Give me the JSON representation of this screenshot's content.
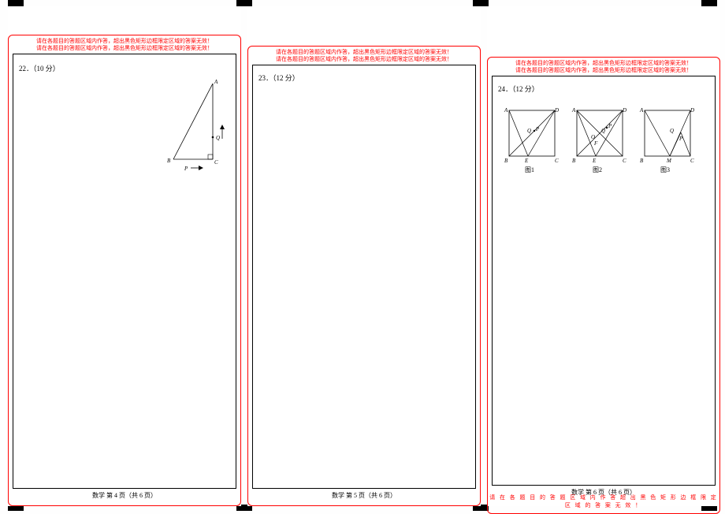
{
  "warnings": {
    "line1": "请在各题目的答题区域内作答，超出黑色矩形边框限定区域的答案无效！",
    "line2": "请在各题目的答题区域内作答，超出黑色矩形边框限定区域的答案无效！",
    "bottom": "请 在 各 题 目 的 答 题 区 域 内 作 答       超 出 黑 色 矩 形 边 框 限 定 区 域 的 答 案 无 效 ！"
  },
  "col1": {
    "question": "22．（10 分）",
    "footer": "数学  第 4 页（共 6 页）",
    "triangle": {
      "A": "A",
      "B": "B",
      "C": "C",
      "P": "P",
      "Q": "Q"
    }
  },
  "col2": {
    "question": "23．（12 分）",
    "footer": "数学  第 5 页（共 6 页）"
  },
  "col3": {
    "question": "24．（12 分）",
    "footer": "数学  第 6 页（共 6 页）",
    "fig": {
      "A": "A",
      "B": "B",
      "C": "C",
      "D": "D",
      "E": "E",
      "F": "F",
      "P": "P",
      "Q": "Q",
      "O": "O",
      "M": "M",
      "cap1": "图1",
      "cap2": "图2",
      "cap3": "图3"
    }
  }
}
